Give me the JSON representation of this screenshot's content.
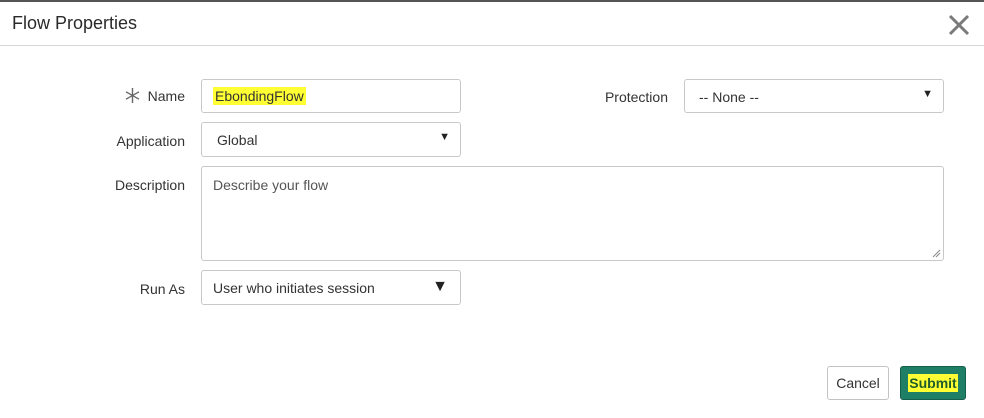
{
  "dialog": {
    "title": "Flow Properties"
  },
  "form": {
    "name": {
      "label": "Name",
      "value": "EbondingFlow"
    },
    "protection": {
      "label": "Protection",
      "value": "-- None --"
    },
    "application": {
      "label": "Application",
      "value": "Global"
    },
    "description": {
      "label": "Description",
      "placeholder": "Describe your flow"
    },
    "run_as": {
      "label": "Run As",
      "value": "User who initiates session"
    }
  },
  "buttons": {
    "cancel": "Cancel",
    "submit": "Submit"
  },
  "icons": {
    "close": "close-icon",
    "required": "required-asterisk-icon",
    "dropdown": "caret-down-icon"
  },
  "colors": {
    "highlight": "#ffff33",
    "submit_bg": "#1f7f66"
  }
}
